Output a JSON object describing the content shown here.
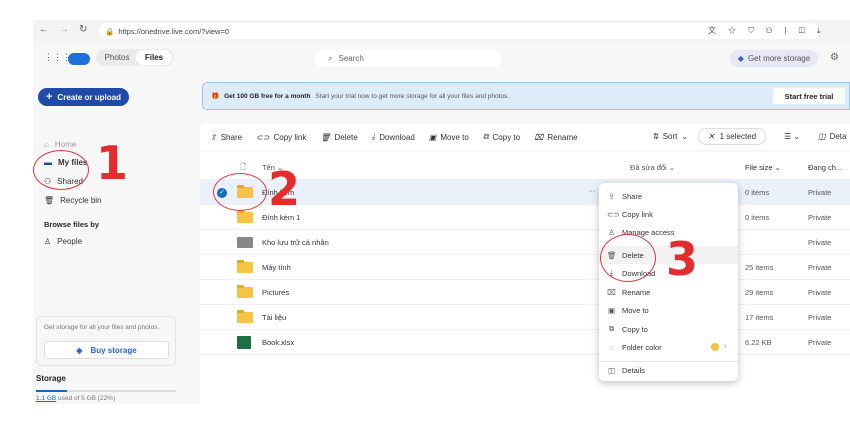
{
  "browser": {
    "url": "https://onedrive.live.com/?view=0"
  },
  "header": {
    "tabs": [
      "Photos",
      "Files"
    ],
    "active_tab": "Files",
    "search_placeholder": "Search",
    "get_storage": "Get more storage"
  },
  "sidebar": {
    "create": "Create or upload",
    "items": [
      "Home",
      "My files",
      "Shared",
      "Recycle bin"
    ],
    "active": "My files",
    "browse_heading": "Browse files by",
    "people": "People",
    "promo_text": "Get storage for all your files and photos.",
    "buy": "Buy storage",
    "storage_heading": "Storage",
    "storage_used": "1.1 GB",
    "storage_rest": " used of 5 GB (22%)",
    "storage_fraction": 0.22
  },
  "banner": {
    "bold": "Get 100 GB free for a month",
    "text": "Start your trial now to get more storage for all your files and photos.",
    "button": "Start free trial"
  },
  "toolbar": {
    "share": "Share",
    "copy_link": "Copy link",
    "delete": "Delete",
    "download": "Download",
    "move_to": "Move to",
    "copy_to": "Copy to",
    "rename": "Rename",
    "sort": "Sort",
    "selected": "1 selected",
    "details": "Deta"
  },
  "columns": {
    "name": "Tên",
    "modified": "Đã sửa đổi",
    "size": "File size",
    "sharing": "Đang ch..."
  },
  "rows": [
    {
      "name": "Đính kèm",
      "size": "0 items",
      "sharing": "Private",
      "type": "folder"
    },
    {
      "name": "Đính kèm 1",
      "size": "0 items",
      "sharing": "Private",
      "type": "folder"
    },
    {
      "name": "Kho lưu trữ cá nhân",
      "size": "",
      "sharing": "Private",
      "type": "vault"
    },
    {
      "name": "Máy tính",
      "size": "25 items",
      "sharing": "Private",
      "type": "folder"
    },
    {
      "name": "Pictures",
      "size": "29 items",
      "sharing": "Private",
      "type": "folder"
    },
    {
      "name": "Tài liệu",
      "size": "17 items",
      "sharing": "Private",
      "type": "folder"
    },
    {
      "name": "Book.xlsx",
      "size": "6.22 KB",
      "sharing": "Private",
      "type": "excel"
    }
  ],
  "menu": [
    "Share",
    "Copy link",
    "Manage access",
    "Delete",
    "Download",
    "Rename",
    "Move to",
    "Copy to",
    "Folder color",
    "Details"
  ],
  "annotations": [
    "1",
    "2",
    "3"
  ],
  "colors": {
    "accent": "#0f6cbd",
    "annotation": "#e52b2b",
    "folder": "#f6c344"
  }
}
